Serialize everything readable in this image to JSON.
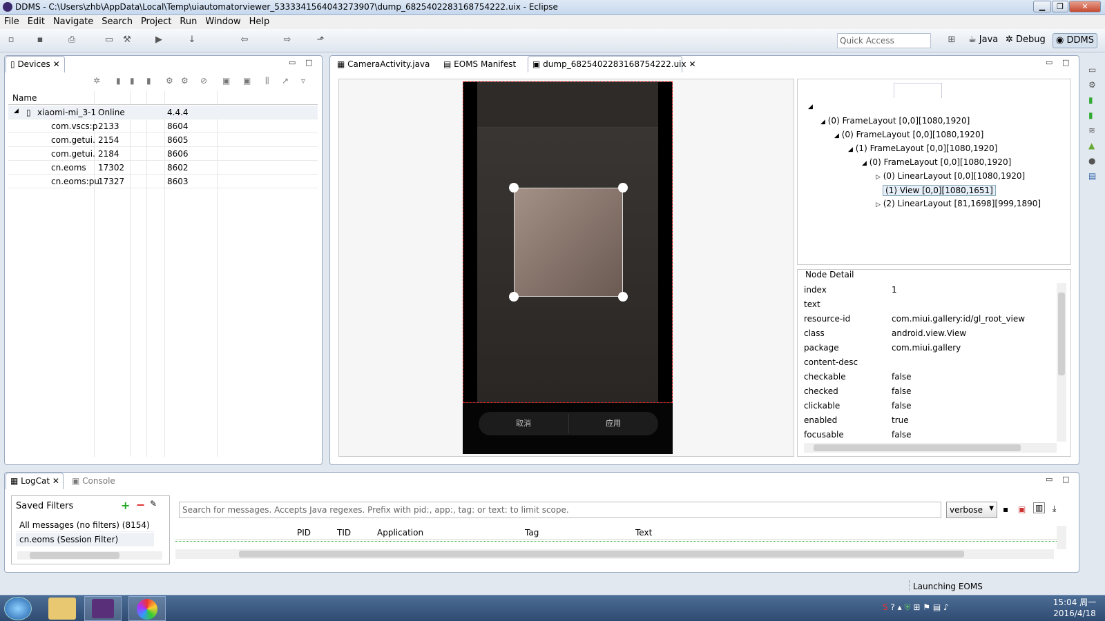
{
  "window": {
    "title": "DDMS - C:\\Users\\zhb\\AppData\\Local\\Temp\\uiautomatorviewer_5333341564043273907\\dump_6825402283168754222.uix - Eclipse"
  },
  "menu": [
    "File",
    "Edit",
    "Navigate",
    "Search",
    "Project",
    "Run",
    "Window",
    "Help"
  ],
  "toolbar": {
    "quick_access_placeholder": "Quick Access",
    "perspectives": [
      "Java",
      "Debug",
      "DDMS"
    ]
  },
  "devices": {
    "tab_label": "Devices",
    "column_name": "Name",
    "device": {
      "name": "xiaomi-mi_3-1",
      "status": "Online",
      "version": "4.4.4"
    },
    "processes": [
      {
        "name": "com.vscs:p",
        "pid": "2133",
        "port": "8604"
      },
      {
        "name": "com.getui.",
        "pid": "2154",
        "port": "8605"
      },
      {
        "name": "com.getui.",
        "pid": "2184",
        "port": "8606"
      },
      {
        "name": "cn.eoms",
        "pid": "17302",
        "port": "8602"
      },
      {
        "name": "cn.eoms:pu",
        "pid": "17327",
        "port": "8603"
      }
    ]
  },
  "editor_tabs": [
    "CameraActivity.java",
    "EOMS Manifest",
    "dump_6825402283168754222.uix"
  ],
  "phone": {
    "cancel_label": "取消",
    "apply_label": "应用"
  },
  "hierarchy": [
    "(0) FrameLayout [0,0][1080,1920]",
    "(0) FrameLayout [0,0][1080,1920]",
    "(1) FrameLayout [0,0][1080,1920]",
    "(0) FrameLayout [0,0][1080,1920]",
    "(0) LinearLayout [0,0][1080,1920]",
    "(1) View [0,0][1080,1651]",
    "(2) LinearLayout [81,1698][999,1890]"
  ],
  "node_detail": {
    "title": "Node Detail",
    "rows": [
      {
        "k": "index",
        "v": "1"
      },
      {
        "k": "text",
        "v": ""
      },
      {
        "k": "resource-id",
        "v": "com.miui.gallery:id/gl_root_view"
      },
      {
        "k": "class",
        "v": "android.view.View"
      },
      {
        "k": "package",
        "v": "com.miui.gallery"
      },
      {
        "k": "content-desc",
        "v": ""
      },
      {
        "k": "checkable",
        "v": "false"
      },
      {
        "k": "checked",
        "v": "false"
      },
      {
        "k": "clickable",
        "v": "false"
      },
      {
        "k": "enabled",
        "v": "true"
      },
      {
        "k": "focusable",
        "v": "false"
      }
    ]
  },
  "logcat": {
    "tab_label": "LogCat",
    "console_label": "Console",
    "saved_filters_label": "Saved Filters",
    "filters": [
      "All messages (no filters) (8154)",
      "cn.eoms (Session Filter)"
    ],
    "search_placeholder": "Search for messages. Accepts Java regexes. Prefix with pid:, app:, tag: or text: to limit scope.",
    "level": "verbose",
    "columns": [
      "PID",
      "TID",
      "Application",
      "Tag",
      "Text"
    ]
  },
  "status": {
    "message": "Launching EOMS"
  },
  "taskbar": {
    "time": "15:04 周一",
    "date": "2016/4/18"
  }
}
